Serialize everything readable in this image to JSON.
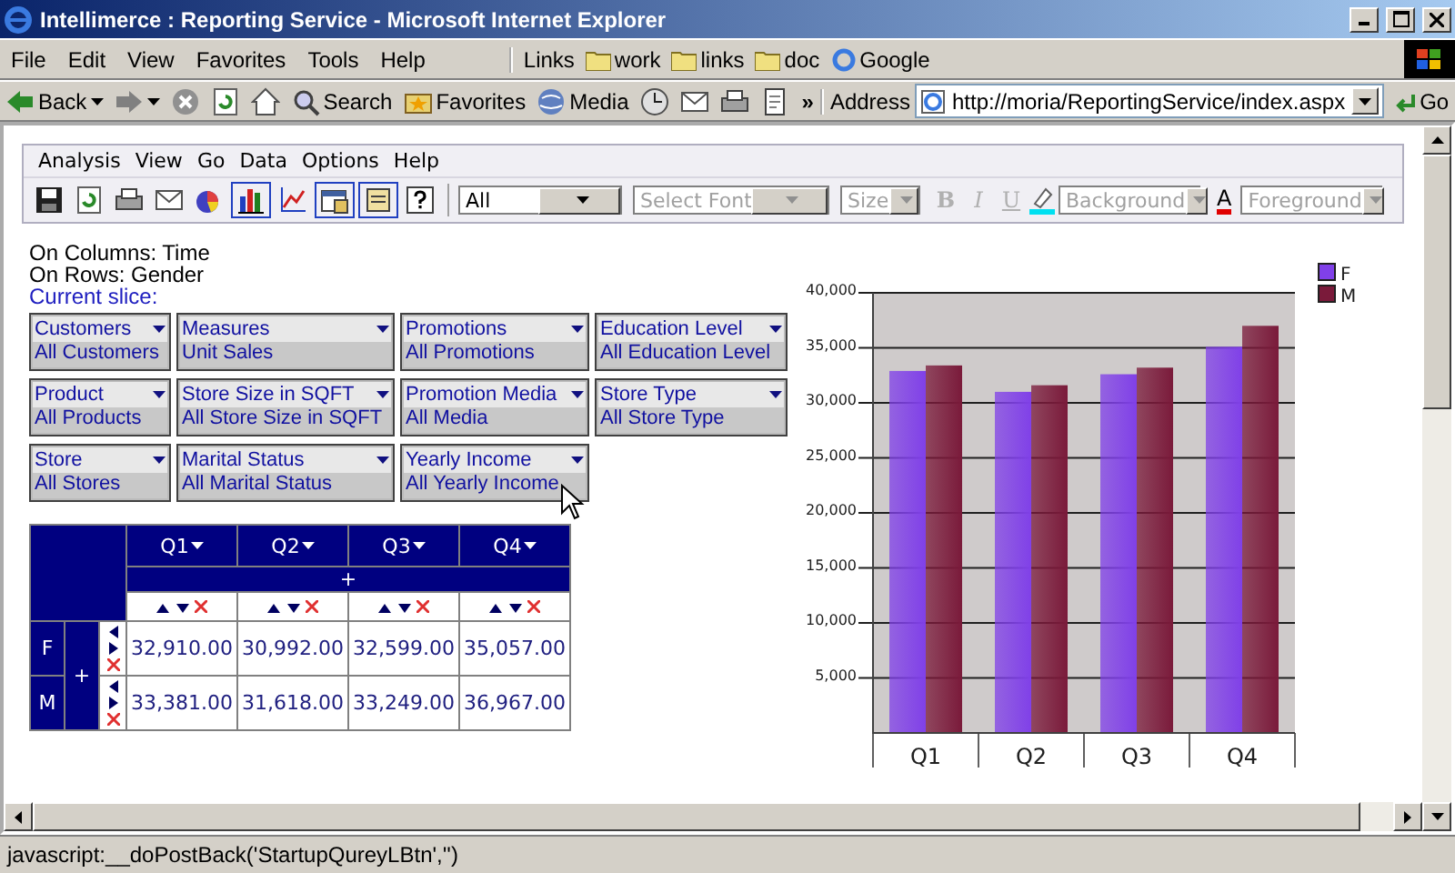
{
  "window": {
    "title": "Intellimerce : Reporting Service - Microsoft Internet Explorer"
  },
  "menu_bar": [
    "File",
    "Edit",
    "View",
    "Favorites",
    "Tools",
    "Help"
  ],
  "links_bar": {
    "label": "Links",
    "links": [
      {
        "label": "work",
        "kind": "folder"
      },
      {
        "label": "links",
        "kind": "folder"
      },
      {
        "label": "doc",
        "kind": "folder"
      },
      {
        "label": "Google",
        "kind": "page"
      }
    ]
  },
  "toolbar": [
    {
      "kind": "back",
      "label": "Back"
    },
    {
      "kind": "forward"
    },
    {
      "kind": "stop"
    },
    {
      "kind": "refresh"
    },
    {
      "kind": "home"
    },
    {
      "kind": "search",
      "label": "Search"
    },
    {
      "kind": "favorites",
      "label": "Favorites"
    },
    {
      "kind": "media",
      "label": "Media"
    },
    {
      "kind": "history"
    },
    {
      "kind": "mail"
    },
    {
      "kind": "print"
    },
    {
      "kind": "edit"
    }
  ],
  "toolbar_overflow": "»",
  "address": {
    "label": "Address",
    "value": "http://moria/ReportingService/index.aspx",
    "go": "Go"
  },
  "app": {
    "menu": [
      "Analysis",
      "View",
      "Go",
      "Data",
      "Options",
      "Help"
    ],
    "tools": [
      {
        "kind": "save",
        "pressed": false
      },
      {
        "kind": "refresh",
        "pressed": false
      },
      {
        "kind": "print",
        "pressed": false
      },
      {
        "kind": "mail",
        "pressed": false
      },
      {
        "kind": "pie",
        "pressed": false
      },
      {
        "kind": "bars",
        "pressed": true
      },
      {
        "kind": "line",
        "pressed": false
      },
      {
        "kind": "properties",
        "pressed": true
      },
      {
        "kind": "layout",
        "pressed": true
      },
      {
        "kind": "help",
        "pressed": false
      }
    ],
    "format_controls": [
      {
        "kind": "select",
        "value": "All",
        "disabled": false
      },
      {
        "kind": "select",
        "value": "Select Font",
        "disabled": true
      },
      {
        "kind": "select",
        "value": "Size",
        "disabled": true
      },
      {
        "kind": "button",
        "label": "B",
        "disabled": true
      },
      {
        "kind": "button",
        "label": "I",
        "disabled": true
      },
      {
        "kind": "button",
        "label": "U",
        "disabled": true
      },
      {
        "kind": "fill-color",
        "value": "Background",
        "disabled": true
      },
      {
        "kind": "font-color",
        "label": "A",
        "value": "Foreground",
        "disabled": true
      }
    ]
  },
  "axes_info": [
    "On Columns: Time",
    "On Rows: Gender"
  ],
  "slice_label": "Current slice:",
  "slicers": [
    {
      "dimension": "Customers",
      "member": "All Customers"
    },
    {
      "dimension": "Measures",
      "member": "Unit Sales"
    },
    {
      "dimension": "Promotions",
      "member": "All Promotions"
    },
    {
      "dimension": "Education Level",
      "member": "All Education Level"
    },
    {
      "dimension": "Product",
      "member": "All Products"
    },
    {
      "dimension": "Store Size in SQFT",
      "member": "All Store Size in SQFT"
    },
    {
      "dimension": "Promotion Media",
      "member": "All Media"
    },
    {
      "dimension": "Store Type",
      "member": "All Store Type"
    },
    {
      "dimension": "Store",
      "member": "All Stores"
    },
    {
      "dimension": "Marital Status",
      "member": "All Marital Status"
    },
    {
      "dimension": "Yearly Income",
      "member": "All Yearly Income"
    }
  ],
  "pivot": {
    "columns": [
      "Q1",
      "Q2",
      "Q3",
      "Q4"
    ],
    "column_expand": "+",
    "row_expand": "+",
    "rows": [
      {
        "label": "F",
        "values": [
          "32,910.00",
          "30,992.00",
          "32,599.00",
          "35,057.00"
        ]
      },
      {
        "label": "M",
        "values": [
          "33,381.00",
          "31,618.00",
          "33,249.00",
          "36,967.00"
        ]
      }
    ]
  },
  "chart": {
    "chart_data": {
      "type": "bar",
      "categories": [
        "Q1",
        "Q2",
        "Q3",
        "Q4"
      ],
      "series": [
        {
          "name": "F",
          "color": "#8040e8",
          "values": [
            32900,
            31000,
            32600,
            35100
          ]
        },
        {
          "name": "M",
          "color": "#7a1a3a",
          "values": [
            33400,
            31600,
            33200,
            37000
          ]
        }
      ],
      "grid": true,
      "legend": true,
      "ylim": [
        0,
        40000
      ],
      "yticks": [
        {
          "value": 5000,
          "label": "5,000"
        },
        {
          "value": 10000,
          "label": "10,000"
        },
        {
          "value": 15000,
          "label": "15,000"
        },
        {
          "value": 20000,
          "label": "20,000"
        },
        {
          "value": 25000,
          "label": "25,000"
        },
        {
          "value": 30000,
          "label": "30,000"
        },
        {
          "value": 35000,
          "label": "35,000"
        },
        {
          "value": 40000,
          "label": "40,000"
        }
      ]
    }
  },
  "status_bar": "javascript:__doPostBack('StartupQureyLBtn','')"
}
